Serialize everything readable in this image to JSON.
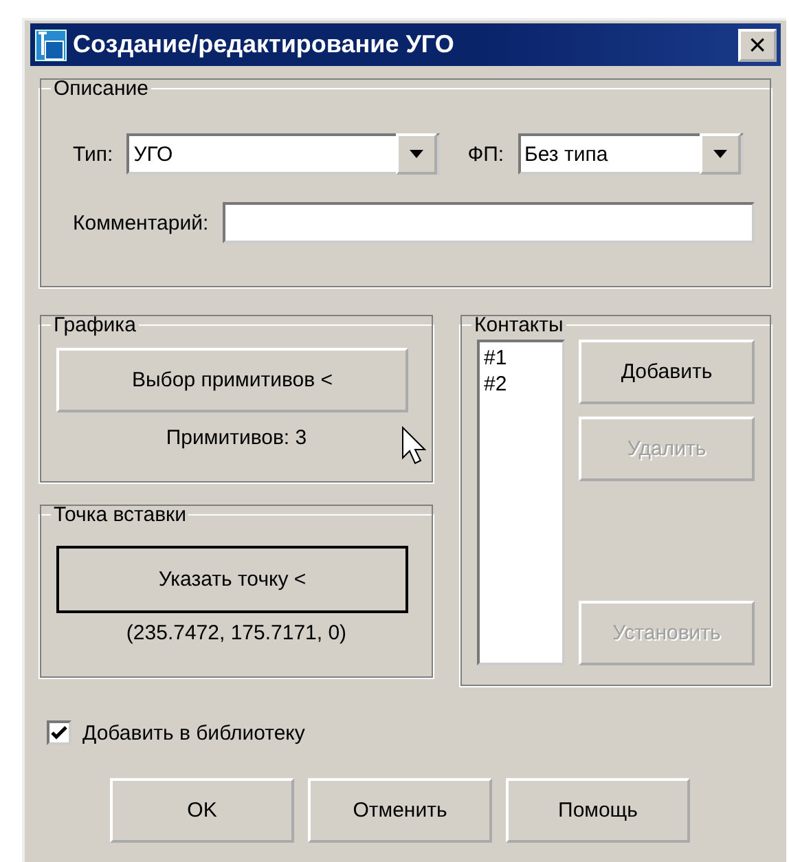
{
  "window": {
    "title": "Создание/редактирование УГО",
    "close": "×"
  },
  "description": {
    "title": "Описание",
    "type_label": "Тип:",
    "type_value": "УГО",
    "fp_label": "ФП:",
    "fp_value": "Без типа",
    "comment_label": "Комментарий:"
  },
  "graphics": {
    "title": "Графика",
    "button": {
      "label": "Выбор примитивов <",
      "disabled": false,
      "default": false
    },
    "count": "Примитивов: 3"
  },
  "insert_point": {
    "title": "Точка вставки",
    "button": {
      "label": "Указать точку <",
      "disabled": false,
      "default": true
    },
    "coords": "(235.7472, 175.7171, 0)"
  },
  "contacts": {
    "title": "Контакты",
    "items": [
      {
        "label": "#1",
        "selected": false
      },
      {
        "label": "#2",
        "selected": false
      }
    ],
    "buttons": [
      {
        "label": "Добавить",
        "disabled": false
      },
      {
        "label": "Удалить",
        "disabled": true
      },
      {
        "label": "Установить",
        "disabled": true
      }
    ]
  },
  "add_to_library": {
    "label": "Добавить в библиотеку",
    "checked": true
  },
  "buttons": [
    {
      "label": "OK",
      "disabled": false
    },
    {
      "label": "Отменить",
      "disabled": false
    },
    {
      "label": "Помощь",
      "disabled": false
    }
  ]
}
